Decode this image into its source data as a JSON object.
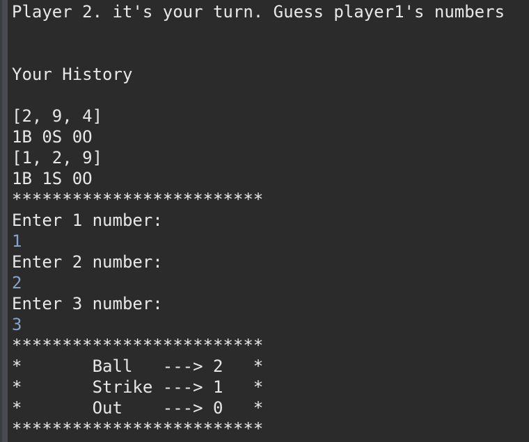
{
  "console": {
    "prompt_title": "Player 2. it's your turn. Guess player1's numbers",
    "history_heading": "Your History",
    "history": [
      {
        "guess": "[2, 9, 4]",
        "result": "1B 0S 0O"
      },
      {
        "guess": "[1, 2, 9]",
        "result": "1B 1S 0O"
      }
    ],
    "separator": "*************************",
    "inputs": [
      {
        "prompt": "Enter 1 number:",
        "value": "1"
      },
      {
        "prompt": "Enter 2 number:",
        "value": "2"
      },
      {
        "prompt": "Enter 3 number:",
        "value": "3"
      }
    ],
    "results": [
      "*       Ball   ---> 2   *",
      "*       Strike ---> 1   *",
      "*       Out    ---> 0   *"
    ],
    "input_color": "#86a3cb",
    "background_color": "#2b2b2b"
  }
}
